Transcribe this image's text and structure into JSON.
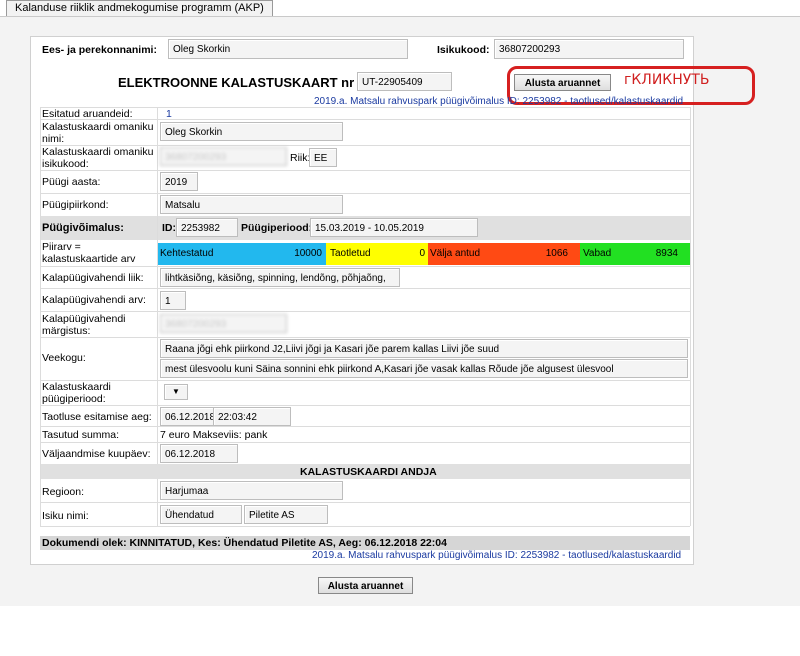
{
  "app": {
    "tab_title": "Kalanduse riiklik andmekogumise programm (AKP)"
  },
  "header": {
    "name_label": "Ees- ja perekonnanimi:",
    "name_value": "Oleg Skorkin",
    "id_label": "Isikukood:",
    "id_value": "36807200293"
  },
  "card": {
    "title": "ELEKTROONNE KALASTUSKAART nr",
    "number": "UT-22905409",
    "start_report_label": "Alusta aruannet",
    "permit_link": "2019.a. Matsalu rahvuspark püügivõimalus ID: 2253982 - taotlused/kalastuskaardid"
  },
  "annotation": {
    "text": "гКЛИКНУТЬ"
  },
  "fields": {
    "reports_label": "Esitatud aruandeid:",
    "reports_value": "1",
    "owner_name_label": "Kalastuskaardi omaniku nimi:",
    "owner_name_value": "Oleg Skorkin",
    "owner_id_label": "Kalastuskaardi omaniku isikukood:",
    "owner_id_value": "36807200293",
    "country_label": "Riik:",
    "country_value": "EE",
    "year_label": "Püügi aasta:",
    "year_value": "2019",
    "region_label": "Püügipiirkond:",
    "region_value": "Matsalu",
    "opportunity_label": "Püügivõimalus:",
    "id_prefix": "ID:",
    "opportunity_id": "2253982",
    "period_label": "Püügiperiood:",
    "period_value": "15.03.2019 - 10.05.2019",
    "limit_label": "Piirarv = kalastuskaartide arv",
    "gear_type_label": "Kalapüügivahendi liik:",
    "gear_type_value": "lihtkäsiõng, käsiõng, spinning, lendõng, põhjaõng,",
    "gear_count_label": "Kalapüügivahendi arv:",
    "gear_count_value": "1",
    "gear_mark_label": "Kalapüügivahendi märgistus:",
    "gear_mark_value": "36807200293",
    "water_label": "Veekogu:",
    "water_value_1": "Raana jõgi ehk piirkond J2,Liivi jõgi ja Kasari jõe parem kallas Liivi jõe suud",
    "water_value_2": "mest ülesvoolu kuni Säina sonnini ehk piirkond A,Kasari jõe vasak kallas Rõude jõe algusest ülesvool",
    "card_period_label": "Kalastuskaardi püügiperiood:",
    "card_period_value": "",
    "apply_time_label": "Taotluse esitamise aeg:",
    "apply_date": "06.12.2018",
    "apply_time": "22:03:42",
    "paid_label": "Tasutud summa:",
    "paid_value": "7 euro Makseviis: pank",
    "issue_date_label": "Väljaandmise kuupäev:",
    "issue_date": "06.12.2018"
  },
  "limits": [
    {
      "label": "Kehtestatud",
      "value": "10000",
      "color": "#22b8ee"
    },
    {
      "label": "Taotletud",
      "value": "0",
      "color": "#ffff00"
    },
    {
      "label": "Välja antud",
      "value": "1066",
      "color": "#ff4a14"
    },
    {
      "label": "Vabad",
      "value": "8934",
      "color": "#22e022"
    }
  ],
  "issuer": {
    "section_title": "KALASTUSKAARDI ANDJA",
    "region_label": "Regioon:",
    "region_value": "Harjumaa",
    "person_label": "Isiku nimi:",
    "person_value_1": "Ühendatud",
    "person_value_2": "Piletite AS"
  },
  "footer": {
    "status_text": "Dokumendi olek: KINNITATUD, Kes: Ühendatud Piletite AS, Aeg: 06.12.2018 22:04",
    "link": "2019.a. Matsalu rahvuspark püügivõimalus ID: 2253982 - taotlused/kalastuskaardid",
    "button_label": "Alusta aruannet"
  }
}
